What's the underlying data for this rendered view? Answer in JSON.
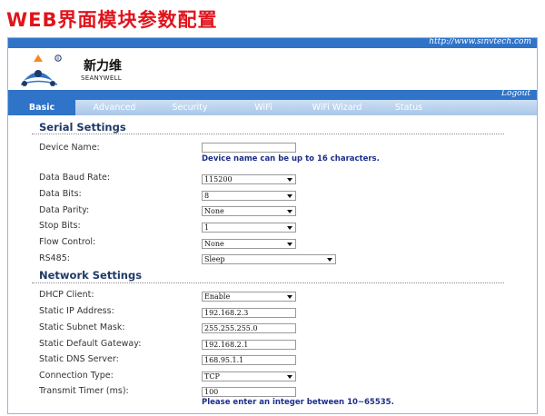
{
  "heading": "WEB界面模块参数配置",
  "header": {
    "url": "http://www.sinvtech.com",
    "logout": "Logout"
  },
  "brand": {
    "name_cn": "新力维",
    "name_en": "SEANYWELL",
    "logo_icon": "tri-dot-logo-icon",
    "logo_colors": [
      "#f5891f",
      "#2f74c8",
      "#1f3a68"
    ]
  },
  "tabs": [
    {
      "label": "Basic",
      "active": true
    },
    {
      "label": "Advanced",
      "active": false
    },
    {
      "label": "Security",
      "active": false
    },
    {
      "label": "WiFi",
      "active": false
    },
    {
      "label": "WiFi Wizard",
      "active": false
    },
    {
      "label": "Status",
      "active": false
    }
  ],
  "serial": {
    "title": "Serial Settings",
    "device_name": {
      "label": "Device Name:",
      "value": "",
      "hint": "Device name can be up to 16 characters."
    },
    "baud_rate": {
      "label": "Data Baud Rate:",
      "value": "115200"
    },
    "data_bits": {
      "label": "Data Bits:",
      "value": "8"
    },
    "parity": {
      "label": "Data Parity:",
      "value": "None"
    },
    "stop_bits": {
      "label": "Stop Bits:",
      "value": "1"
    },
    "flow_control": {
      "label": "Flow Control:",
      "value": "None"
    },
    "rs485": {
      "label": "RS485:",
      "value": "Sleep"
    }
  },
  "network": {
    "title": "Network Settings",
    "dhcp": {
      "label": "DHCP Client:",
      "value": "Enable"
    },
    "ip": {
      "label": "Static IP Address:",
      "value": "192.168.2.3"
    },
    "mask": {
      "label": "Static Subnet Mask:",
      "value": "255.255.255.0"
    },
    "gateway": {
      "label": "Static Default Gateway:",
      "value": "192.168.2.1"
    },
    "dns": {
      "label": "Static DNS Server:",
      "value": "168.95.1.1"
    },
    "conn_type": {
      "label": "Connection Type:",
      "value": "TCP"
    },
    "timer": {
      "label": "Transmit Timer (ms):",
      "value": "100",
      "hint": "Please enter an integer between 10~65535."
    }
  },
  "colors": {
    "accent": "#2f74c8",
    "heading": "#e0141c",
    "section_title": "#1f3a68",
    "hint": "#1b2f8a"
  }
}
